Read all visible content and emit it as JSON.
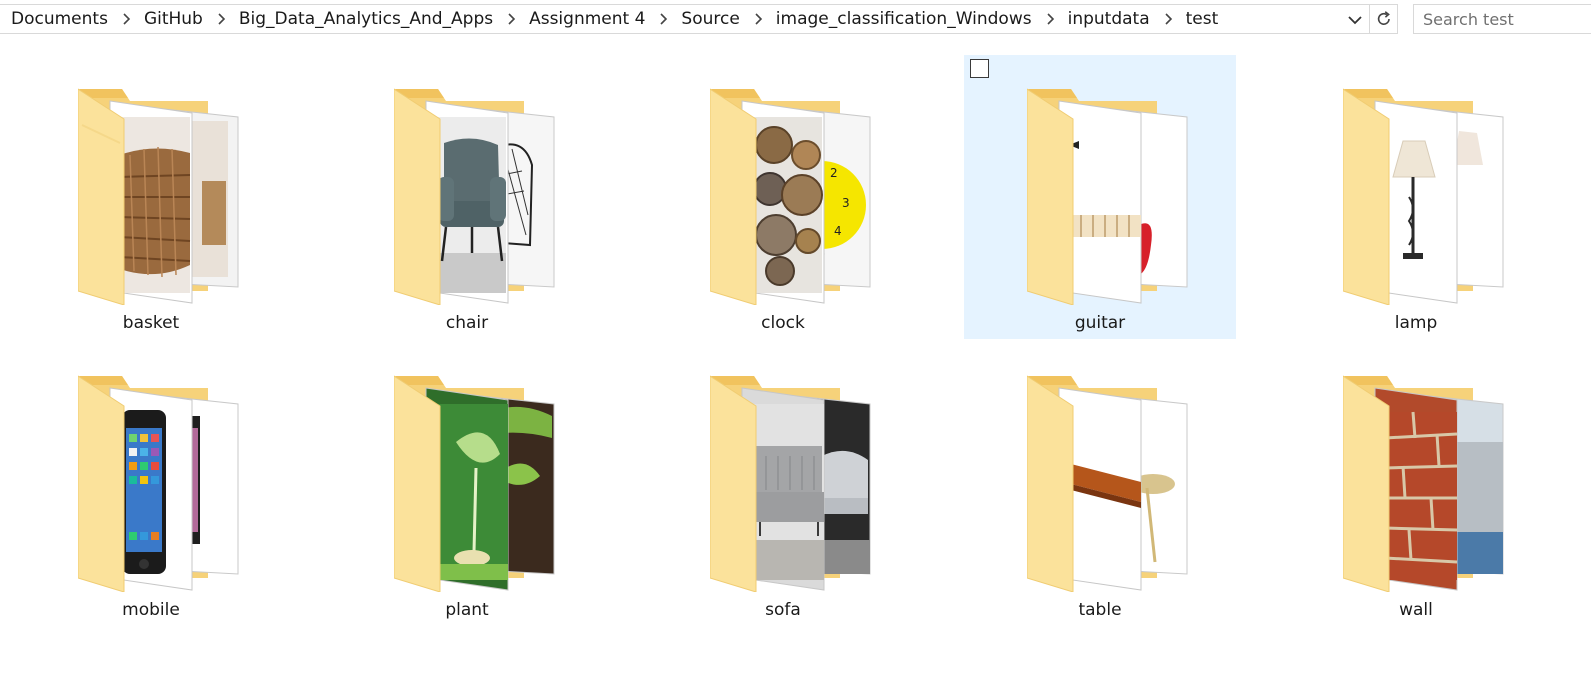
{
  "address_bar": {
    "breadcrumbs": [
      "Documents",
      "GitHub",
      "Big_Data_Analytics_And_Apps",
      "Assignment 4",
      "Source",
      "image_classification_Windows",
      "inputdata",
      "test"
    ],
    "dropdown_icon": "chevron-down-icon",
    "refresh_icon": "refresh-icon"
  },
  "search": {
    "placeholder": "Search test",
    "value": ""
  },
  "folders": [
    {
      "name": "basket",
      "preview": "woven wicker baskets",
      "selected": false
    },
    {
      "name": "chair",
      "preview": "teal armchair and wire chair",
      "selected": false
    },
    {
      "name": "clock",
      "preview": "decorative wall clocks and yellow clock",
      "selected": false
    },
    {
      "name": "guitar",
      "preview": "red electric guitar",
      "selected": true
    },
    {
      "name": "lamp",
      "preview": "table lamps",
      "selected": false
    },
    {
      "name": "mobile",
      "preview": "smartphones",
      "selected": false
    },
    {
      "name": "plant",
      "preview": "seedlings",
      "selected": false
    },
    {
      "name": "sofa",
      "preview": "grey sofas",
      "selected": false
    },
    {
      "name": "table",
      "preview": "wooden tables",
      "selected": false
    },
    {
      "name": "wall",
      "preview": "brick wall and concrete wall",
      "selected": false
    }
  ],
  "colors": {
    "folder_back": "#f6d27a",
    "folder_front": "#fbe29b",
    "selection": "#e5f3ff",
    "border": "#d9d9d9"
  }
}
